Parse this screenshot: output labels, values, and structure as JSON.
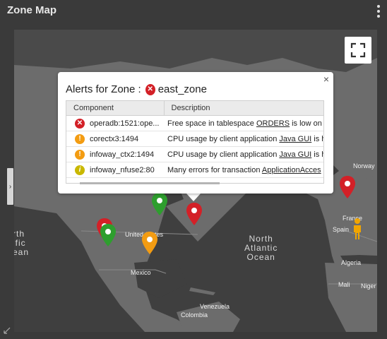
{
  "widget": {
    "title": "Zone Map"
  },
  "map": {
    "ocean_labels": {
      "north_atlantic": "North\nAtlantic\nOcean",
      "north_pacific_partial": "rth\nific\nean"
    },
    "places": {
      "norway": "Norway",
      "france": "France",
      "spain": "Spain",
      "algeria": "Algeria",
      "mali": "Mali",
      "niger": "Niger",
      "united_states": "United States",
      "mexico": "Mexico",
      "venezuela": "Venezuela",
      "colombia": "Colombia"
    },
    "markers": [
      {
        "status": "critical",
        "color": "#d32027"
      },
      {
        "status": "ok",
        "color": "#2e9e2e"
      },
      {
        "status": "critical",
        "color": "#d32027"
      },
      {
        "status": "ok",
        "color": "#2e9e2e"
      },
      {
        "status": "warning",
        "color": "#f39c12"
      },
      {
        "status": "critical",
        "color": "#d32027"
      }
    ]
  },
  "popup": {
    "title_prefix": "Alerts for Zone :",
    "zone_name": "east_zone",
    "zone_status_icon": "critical-x-icon",
    "close_glyph": "×",
    "columns": {
      "component": "Component",
      "description": "Description"
    },
    "rows": [
      {
        "severity": "critical",
        "icon": "x",
        "component": "operadb:1521:ope...",
        "desc_prefix": "Free space in tablespace ",
        "desc_link": "ORDERS",
        "desc_suffix": " is low on ",
        "desc_link2": "C"
      },
      {
        "severity": "major",
        "icon": "!",
        "component": "corectx3:1494",
        "desc_prefix": "CPU usage by client application ",
        "desc_link": "Java GUI",
        "desc_suffix": " is h",
        "desc_link2": ""
      },
      {
        "severity": "major",
        "icon": "!",
        "component": "infoway_ctx2:1494",
        "desc_prefix": "CPU usage by client application ",
        "desc_link": "Java GUI",
        "desc_suffix": " is h",
        "desc_link2": ""
      },
      {
        "severity": "minor",
        "icon": "i",
        "component": "infoway_nfuse2:80",
        "desc_prefix": "Many errors for transaction ",
        "desc_link": "ApplicationAcces",
        "desc_suffix": "",
        "desc_link2": ""
      }
    ]
  },
  "colors": {
    "critical": "#d32027",
    "major": "#f39c12",
    "minor": "#c9b800",
    "ok": "#2e9e2e",
    "map_land": "#6c6c6c",
    "map_water": "#3f3f3f",
    "person": "#f0a500"
  }
}
